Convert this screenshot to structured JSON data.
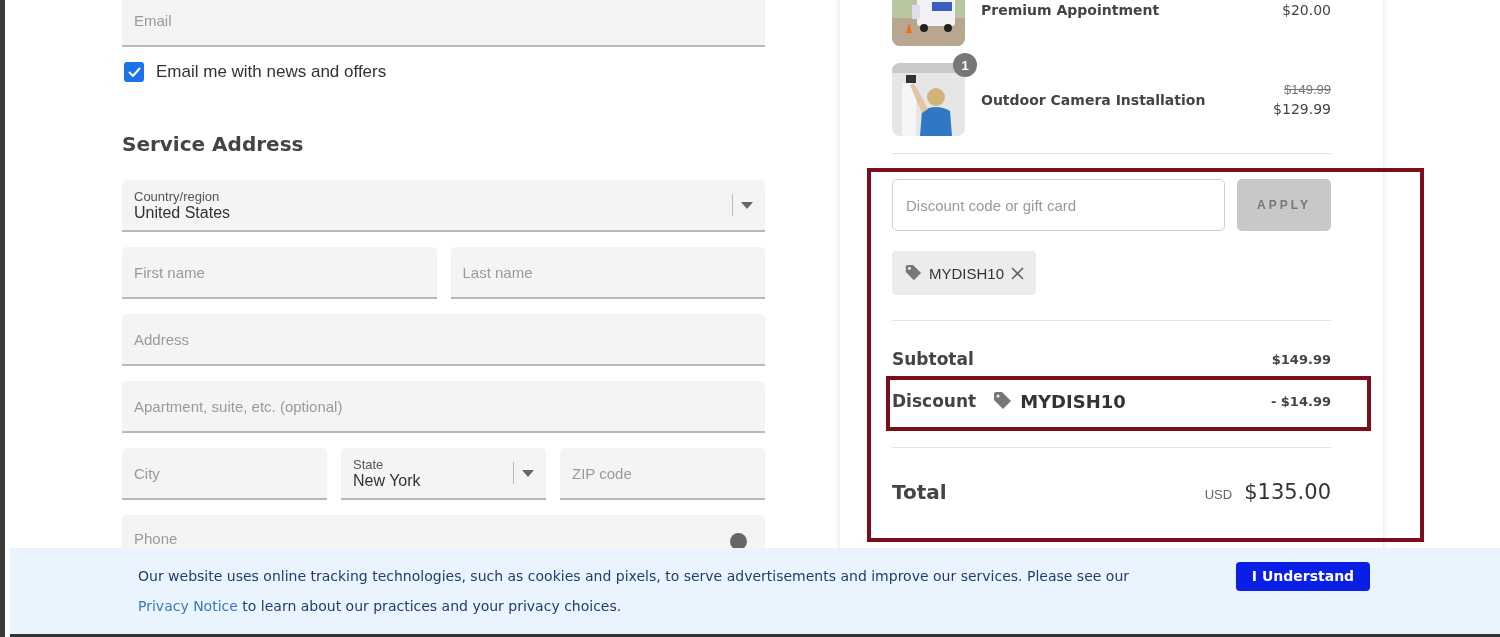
{
  "contact": {
    "email": {
      "placeholder": "Email"
    },
    "newsletter": {
      "label": "Email me with news and offers",
      "checked": true
    }
  },
  "service_address": {
    "heading": "Service Address",
    "rows": [
      [
        {
          "kind": "select",
          "label": "Country/region",
          "value": "United States"
        }
      ],
      [
        {
          "kind": "text",
          "placeholder": "First name"
        },
        {
          "kind": "text",
          "placeholder": "Last name"
        }
      ],
      [
        {
          "kind": "text",
          "placeholder": "Address"
        }
      ],
      [
        {
          "kind": "text",
          "placeholder": "Apartment, suite, etc. (optional)"
        }
      ],
      [
        {
          "kind": "text",
          "placeholder": "City"
        },
        {
          "kind": "select",
          "label": "State",
          "value": "New York"
        },
        {
          "kind": "text",
          "placeholder": "ZIP code"
        }
      ],
      [
        {
          "kind": "help",
          "placeholder": "Phone"
        }
      ]
    ]
  },
  "order": {
    "items": [
      {
        "kind": "van",
        "name": "Premium Appointment",
        "price": "$20.00"
      },
      {
        "kind": "camera",
        "name": "Outdoor Camera Installation",
        "quantity": "1",
        "original_price": "$149.99",
        "price": "$129.99"
      }
    ],
    "discount": {
      "placeholder": "Discount code or gift card",
      "button": "APPLY",
      "button_disabled": true,
      "applied": [
        {
          "code": "MYDISH10"
        }
      ]
    },
    "summary": {
      "subtotal_label": "Subtotal",
      "subtotal": "$149.99",
      "discount_label": "Discount",
      "discount_code": "MYDISH10",
      "discount": "- $14.99",
      "total_label": "Total",
      "currency": "USD",
      "total": "$135.00"
    }
  },
  "cookie_banner": {
    "text": "Our website uses online tracking technologies, such as cookies and pixels, to serve advertisements and improve our services. Please see our",
    "link": "Privacy Notice",
    "text_after": " to learn about our practices and your privacy choices.",
    "button": "I Understand"
  }
}
